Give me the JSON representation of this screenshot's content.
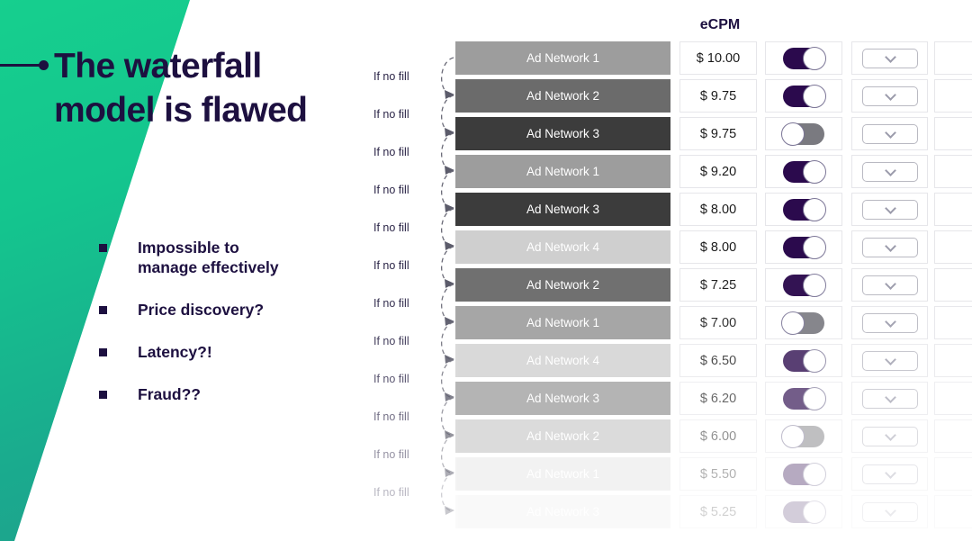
{
  "slide": {
    "title_lines": [
      "The waterfall",
      "model is flawed"
    ],
    "accent_color": "#1d1040",
    "green_start": "#16cf8e",
    "green_end": "#1f9f8c",
    "bullets": [
      "Impossible to\nmanage effectively",
      "Price discovery?",
      "Latency?!",
      "Fraud??"
    ]
  },
  "diagram": {
    "ecpm_header": "eCPM",
    "nofill_label": "If no fill",
    "nofill_count": 12,
    "toggle_on_color": "#2b0a4d",
    "toggle_off_color": "#7a7a80",
    "rows": [
      {
        "network": "Ad Network 1",
        "ecpm": "$ 10.00",
        "bar_color": "#9d9d9d",
        "toggle": "on",
        "opacity": 1.0
      },
      {
        "network": "Ad Network 2",
        "ecpm": "$ 9.75",
        "bar_color": "#6b6b6b",
        "toggle": "on",
        "opacity": 1.0
      },
      {
        "network": "Ad Network 3",
        "ecpm": "$ 9.75",
        "bar_color": "#3c3c3c",
        "toggle": "off",
        "opacity": 1.0
      },
      {
        "network": "Ad Network 1",
        "ecpm": "$ 9.20",
        "bar_color": "#9d9d9d",
        "toggle": "on",
        "opacity": 1.0
      },
      {
        "network": "Ad Network 3",
        "ecpm": "$ 8.00",
        "bar_color": "#3c3c3c",
        "toggle": "on",
        "opacity": 1.0
      },
      {
        "network": "Ad Network 4",
        "ecpm": "$ 8.00",
        "bar_color": "#cfcfcf",
        "toggle": "on",
        "opacity": 1.0
      },
      {
        "network": "Ad Network 2",
        "ecpm": "$ 7.25",
        "bar_color": "#6b6b6b",
        "toggle": "on",
        "opacity": 0.96
      },
      {
        "network": "Ad Network 1",
        "ecpm": "$ 7.00",
        "bar_color": "#9d9d9d",
        "toggle": "off",
        "opacity": 0.9
      },
      {
        "network": "Ad Network 4",
        "ecpm": "$ 6.50",
        "bar_color": "#cfcfcf",
        "toggle": "on",
        "opacity": 0.78
      },
      {
        "network": "Ad Network 3",
        "ecpm": "$ 6.20",
        "bar_color": "#8e8e8e",
        "toggle": "on",
        "opacity": 0.66
      },
      {
        "network": "Ad Network 2",
        "ecpm": "$ 6.00",
        "bar_color": "#b5b5b5",
        "toggle": "off",
        "opacity": 0.48
      },
      {
        "network": "Ad Network 1",
        "ecpm": "$ 5.50",
        "bar_color": "#dcdcdc",
        "toggle": "on",
        "opacity": 0.34
      },
      {
        "network": "Ad Network 3",
        "ecpm": "$ 5.25",
        "bar_color": "#e4e4e4",
        "toggle": "on",
        "opacity": 0.2
      }
    ]
  }
}
